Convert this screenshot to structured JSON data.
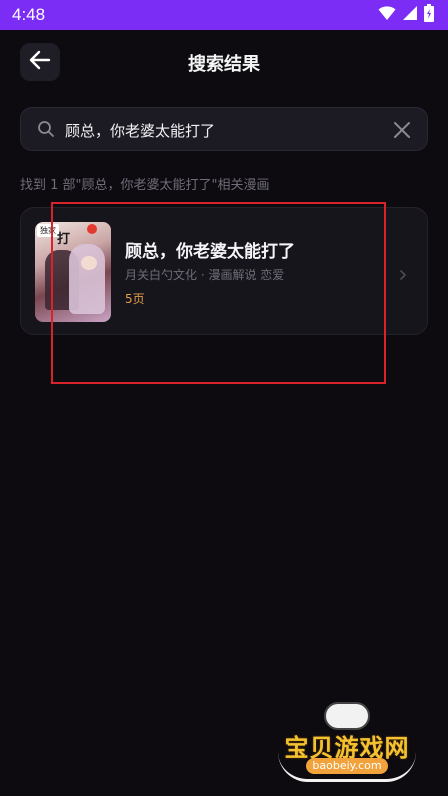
{
  "status_bar": {
    "time": "4:48",
    "accent": "#7b2cf5"
  },
  "header": {
    "title": "搜索结果",
    "back_icon": "arrow-left-icon"
  },
  "search": {
    "query": "顾总，你老婆太能打了",
    "search_icon": "search-icon",
    "clear_icon": "close-icon"
  },
  "results": {
    "count_text": "找到 1 部\"顾总，你老婆太能打了\"相关漫画",
    "items": [
      {
        "title": "顾总，你老婆太能打了",
        "meta": "月关白勺文化 · 漫画解说 恋爱",
        "pages": "5页",
        "cover_tag": "独家",
        "cover_glyph": "打"
      }
    ]
  },
  "watermark": {
    "text": "宝贝游戏网",
    "url": "baobeiy.com"
  }
}
